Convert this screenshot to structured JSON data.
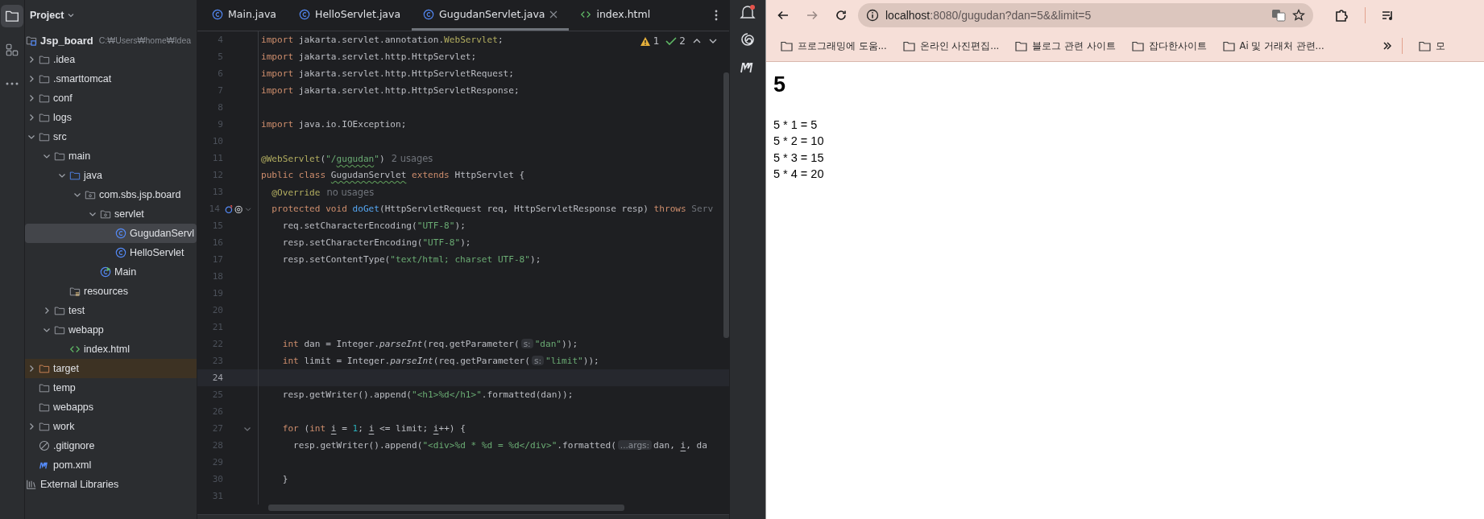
{
  "tool_strip": {
    "items": [
      {
        "kind": "project",
        "selected": true
      },
      {
        "kind": "structure",
        "selected": false
      },
      {
        "kind": "more",
        "selected": false
      }
    ]
  },
  "project": {
    "title": "Project",
    "tree": [
      {
        "label": "Jsp_board",
        "path": "C:₩Users₩home₩Idea",
        "kind": "module",
        "selected": false,
        "children": [
          {
            "label": ".idea",
            "kind": "folder",
            "expanded": false,
            "selected": false
          },
          {
            "label": ".smarttomcat",
            "kind": "folder",
            "expanded": false,
            "selected": false
          },
          {
            "label": "conf",
            "kind": "folder",
            "expanded": false,
            "selected": false
          },
          {
            "label": "logs",
            "kind": "folder",
            "expanded": false,
            "selected": false
          },
          {
            "label": "src",
            "kind": "folder",
            "expanded": true,
            "selected": false,
            "children": [
              {
                "label": "main",
                "kind": "folder",
                "expanded": true,
                "selected": false,
                "children": [
                  {
                    "label": "java",
                    "kind": "source",
                    "expanded": true,
                    "selected": false,
                    "children": [
                      {
                        "label": "com.sbs.jsp.board",
                        "kind": "package",
                        "expanded": true,
                        "selected": false,
                        "children": [
                          {
                            "label": "servlet",
                            "kind": "package",
                            "expanded": true,
                            "selected": false,
                            "children": [
                              {
                                "label": "GugudanServl",
                                "kind": "class",
                                "selected": true
                              },
                              {
                                "label": "HelloServlet",
                                "kind": "class",
                                "selected": false
                              }
                            ]
                          },
                          {
                            "label": "Main",
                            "kind": "main",
                            "selected": false
                          }
                        ]
                      }
                    ]
                  },
                  {
                    "label": "resources",
                    "kind": "resources",
                    "selected": false
                  }
                ]
              },
              {
                "label": "test",
                "kind": "folder",
                "expanded": false,
                "selected": false
              },
              {
                "label": "webapp",
                "kind": "folder",
                "expanded": true,
                "selected": false,
                "children": [
                  {
                    "label": "index.html",
                    "kind": "html",
                    "selected": false
                  }
                ]
              }
            ]
          },
          {
            "label": "target",
            "kind": "excluded",
            "expanded": false,
            "selected": false
          },
          {
            "label": "temp",
            "kind": "folder",
            "selected": false
          },
          {
            "label": "webapps",
            "kind": "folder",
            "selected": false
          },
          {
            "label": "work",
            "kind": "folder",
            "expanded": false,
            "selected": false
          },
          {
            "label": ".gitignore",
            "kind": "ignore",
            "selected": false
          },
          {
            "label": "pom.xml",
            "kind": "maven",
            "selected": false
          }
        ]
      },
      {
        "label": "External Libraries",
        "kind": "libraries",
        "selected": false
      }
    ]
  },
  "editor": {
    "tabs": [
      {
        "label": "Main.java",
        "kind": "class",
        "selected": false,
        "closable": false
      },
      {
        "label": "HelloServlet.java",
        "kind": "class",
        "selected": false,
        "closable": false
      },
      {
        "label": "GugudanServlet.java",
        "kind": "class",
        "selected": true,
        "closable": true
      },
      {
        "label": "index.html",
        "kind": "html",
        "selected": false,
        "closable": false
      }
    ],
    "warnings": "1",
    "checks": "2",
    "lines": [
      {
        "number": "4",
        "current": false,
        "fold": false,
        "markers": false,
        "tokens": [
          {
            "kind": "kw",
            "text": "import "
          },
          {
            "kind": "plain",
            "text": "jakarta.servlet.annotation."
          },
          {
            "kind": "ann",
            "text": "WebServlet"
          },
          {
            "kind": "plain",
            "text": ";"
          }
        ]
      },
      {
        "number": "5",
        "current": false,
        "fold": false,
        "markers": false,
        "tokens": [
          {
            "kind": "kw",
            "text": "import "
          },
          {
            "kind": "plain",
            "text": "jakarta.servlet.http.HttpServlet;"
          }
        ]
      },
      {
        "number": "6",
        "current": false,
        "fold": false,
        "markers": false,
        "tokens": [
          {
            "kind": "kw",
            "text": "import "
          },
          {
            "kind": "plain",
            "text": "jakarta.servlet.http.HttpServletRequest;"
          }
        ]
      },
      {
        "number": "7",
        "current": false,
        "fold": false,
        "markers": false,
        "tokens": [
          {
            "kind": "kw",
            "text": "import "
          },
          {
            "kind": "plain",
            "text": "jakarta.servlet.http.HttpServletResponse;"
          }
        ]
      },
      {
        "number": "8",
        "current": false,
        "fold": false,
        "markers": false
      },
      {
        "number": "9",
        "current": false,
        "fold": false,
        "markers": false,
        "tokens": [
          {
            "kind": "kw",
            "text": "import "
          },
          {
            "kind": "plain",
            "text": "java.io.IOException;"
          }
        ]
      },
      {
        "number": "10",
        "current": false,
        "fold": false,
        "markers": false
      },
      {
        "number": "11",
        "current": false,
        "fold": false,
        "markers": false,
        "tokens": [
          {
            "kind": "ann",
            "text": "@WebServlet"
          },
          {
            "kind": "plain",
            "text": "("
          },
          {
            "kind": "str",
            "text": "\"/"
          },
          {
            "kind": "strwarn",
            "text": "gugudan"
          },
          {
            "kind": "str",
            "text": "\""
          },
          {
            "kind": "plain",
            "text": ")"
          },
          {
            "kind": "hint",
            "text": "2 usages"
          }
        ]
      },
      {
        "number": "12",
        "current": false,
        "fold": false,
        "markers": false,
        "tokens": [
          {
            "kind": "kw",
            "text": "public class "
          },
          {
            "kind": "warn",
            "text": "GugudanServlet"
          },
          {
            "kind": "kw",
            "text": " extends "
          },
          {
            "kind": "plain",
            "text": "HttpServlet {"
          }
        ]
      },
      {
        "number": "13",
        "current": false,
        "fold": false,
        "markers": false,
        "tokens": [
          {
            "kind": "ann",
            "text": "  @Override"
          },
          {
            "kind": "hint",
            "text": "no usages"
          }
        ]
      },
      {
        "number": "14",
        "current": false,
        "fold": true,
        "markers": true,
        "tokens": [
          {
            "kind": "kw",
            "text": "  protected void "
          },
          {
            "kind": "method",
            "text": "doGet"
          },
          {
            "kind": "plain",
            "text": "(HttpServletRequest req, HttpServletResponse resp) "
          },
          {
            "kind": "kw",
            "text": "throws "
          },
          {
            "kind": "dim",
            "text": "Serv"
          }
        ]
      },
      {
        "number": "15",
        "current": false,
        "fold": false,
        "markers": false,
        "tokens": [
          {
            "kind": "plain",
            "text": "    req.setCharacterEncoding("
          },
          {
            "kind": "str",
            "text": "\"UTF-8\""
          },
          {
            "kind": "plain",
            "text": ");"
          }
        ]
      },
      {
        "number": "16",
        "current": false,
        "fold": false,
        "markers": false,
        "tokens": [
          {
            "kind": "plain",
            "text": "    resp.setCharacterEncoding("
          },
          {
            "kind": "str",
            "text": "\"UTF-8\""
          },
          {
            "kind": "plain",
            "text": ");"
          }
        ]
      },
      {
        "number": "17",
        "current": false,
        "fold": false,
        "markers": false,
        "tokens": [
          {
            "kind": "plain",
            "text": "    resp.setContentType("
          },
          {
            "kind": "str",
            "text": "\"text/html; charset UTF-8\""
          },
          {
            "kind": "plain",
            "text": ");"
          }
        ]
      },
      {
        "number": "18",
        "current": false,
        "fold": false,
        "markers": false
      },
      {
        "number": "19",
        "current": false,
        "fold": false,
        "markers": false
      },
      {
        "number": "20",
        "current": false,
        "fold": false,
        "markers": false
      },
      {
        "number": "21",
        "current": false,
        "fold": false,
        "markers": false
      },
      {
        "number": "22",
        "current": false,
        "fold": false,
        "markers": false,
        "tokens": [
          {
            "kind": "kw",
            "text": "    int "
          },
          {
            "kind": "plain",
            "text": "dan = Integer."
          },
          {
            "kind": "static",
            "text": "parseInt"
          },
          {
            "kind": "plain",
            "text": "(req.getParameter("
          },
          {
            "kind": "inlay",
            "text": "s:"
          },
          {
            "kind": "str",
            "text": "\"dan\""
          },
          {
            "kind": "plain",
            "text": "));"
          }
        ]
      },
      {
        "number": "23",
        "current": false,
        "fold": false,
        "markers": false,
        "tokens": [
          {
            "kind": "kw",
            "text": "    int "
          },
          {
            "kind": "plain",
            "text": "limit = Integer."
          },
          {
            "kind": "static",
            "text": "parseInt"
          },
          {
            "kind": "plain",
            "text": "(req.getParameter("
          },
          {
            "kind": "inlay",
            "text": "s:"
          },
          {
            "kind": "str",
            "text": "\"limit\""
          },
          {
            "kind": "plain",
            "text": "));"
          }
        ]
      },
      {
        "number": "24",
        "current": true,
        "fold": false,
        "markers": false
      },
      {
        "number": "25",
        "current": false,
        "fold": false,
        "markers": false,
        "tokens": [
          {
            "kind": "plain",
            "text": "    resp.getWriter().append("
          },
          {
            "kind": "str",
            "text": "\"<h1>%d</h1>\""
          },
          {
            "kind": "plain",
            "text": ".formatted(dan));"
          }
        ]
      },
      {
        "number": "26",
        "current": false,
        "fold": false,
        "markers": false
      },
      {
        "number": "27",
        "current": false,
        "fold": true,
        "markers": false,
        "tokens": [
          {
            "kind": "kw",
            "text": "    for "
          },
          {
            "kind": "plain",
            "text": "("
          },
          {
            "kind": "kw",
            "text": "int "
          },
          {
            "kind": "var",
            "text": "i"
          },
          {
            "kind": "plain",
            "text": " = "
          },
          {
            "kind": "num",
            "text": "1"
          },
          {
            "kind": "plain",
            "text": "; "
          },
          {
            "kind": "var",
            "text": "i"
          },
          {
            "kind": "plain",
            "text": " <= limit; "
          },
          {
            "kind": "var",
            "text": "i"
          },
          {
            "kind": "plain",
            "text": "++) {"
          }
        ]
      },
      {
        "number": "28",
        "current": false,
        "fold": false,
        "markers": false,
        "tokens": [
          {
            "kind": "plain",
            "text": "      resp.getWriter().append("
          },
          {
            "kind": "str",
            "text": "\"<div>%d * %d = %d</div>\""
          },
          {
            "kind": "plain",
            "text": ".formatted("
          },
          {
            "kind": "inlay",
            "text": "...args:"
          },
          {
            "kind": "plain",
            "text": "dan, "
          },
          {
            "kind": "var",
            "text": "i"
          },
          {
            "kind": "plain",
            "text": ", da"
          }
        ]
      },
      {
        "number": "29",
        "current": false,
        "fold": false,
        "markers": false
      },
      {
        "number": "30",
        "current": false,
        "fold": false,
        "markers": false,
        "tokens": [
          {
            "kind": "plain",
            "text": "    }"
          }
        ]
      },
      {
        "number": "31",
        "current": false,
        "fold": false,
        "markers": false
      }
    ]
  },
  "right_strip": {
    "notification_badge": true
  },
  "browser": {
    "forward_disabled": true,
    "url_host": "localhost",
    "url_path": ":8080/gugudan?dan=5&&limit=5",
    "bookmarks": [
      "프로그래밍에 도움...",
      "온라인 사진편집...",
      "블로그 관련 사이트",
      "잡다한사이트",
      "Ai 및 거래처 관련...",
      "모"
    ],
    "page": {
      "heading": "5",
      "lines": [
        "5 * 1 = 5",
        "5 * 2 = 10",
        "5 * 3 = 15",
        "5 * 4 = 20"
      ]
    }
  }
}
